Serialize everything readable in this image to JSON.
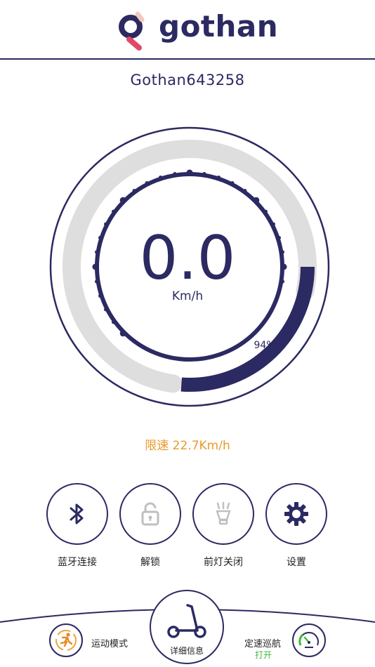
{
  "header": {
    "brand": "gothan"
  },
  "device": {
    "name": "Gothan643258"
  },
  "speedometer": {
    "speed": "0.0",
    "unit": "Km/h",
    "battery_percent_label": "94%",
    "battery_level": 0.94
  },
  "speed_limit": {
    "text": "限速 22.7Km/h"
  },
  "controls": [
    {
      "label": "蓝牙连接",
      "icon": "bluetooth-icon"
    },
    {
      "label": "解锁",
      "icon": "unlock-icon"
    },
    {
      "label": "前灯关闭",
      "icon": "headlight-icon"
    },
    {
      "label": "设置",
      "icon": "gear-icon"
    }
  ],
  "bottom_nav": {
    "mode_label": "运动模式",
    "details_label": "详细信息",
    "cruise_label": "定速巡航",
    "cruise_status": "打开"
  },
  "colors": {
    "primary": "#2b2a62",
    "accent": "#e89a2c",
    "track": "#dedede",
    "logo_pink": "#e0496a",
    "status_green": "#3dbb3d"
  }
}
